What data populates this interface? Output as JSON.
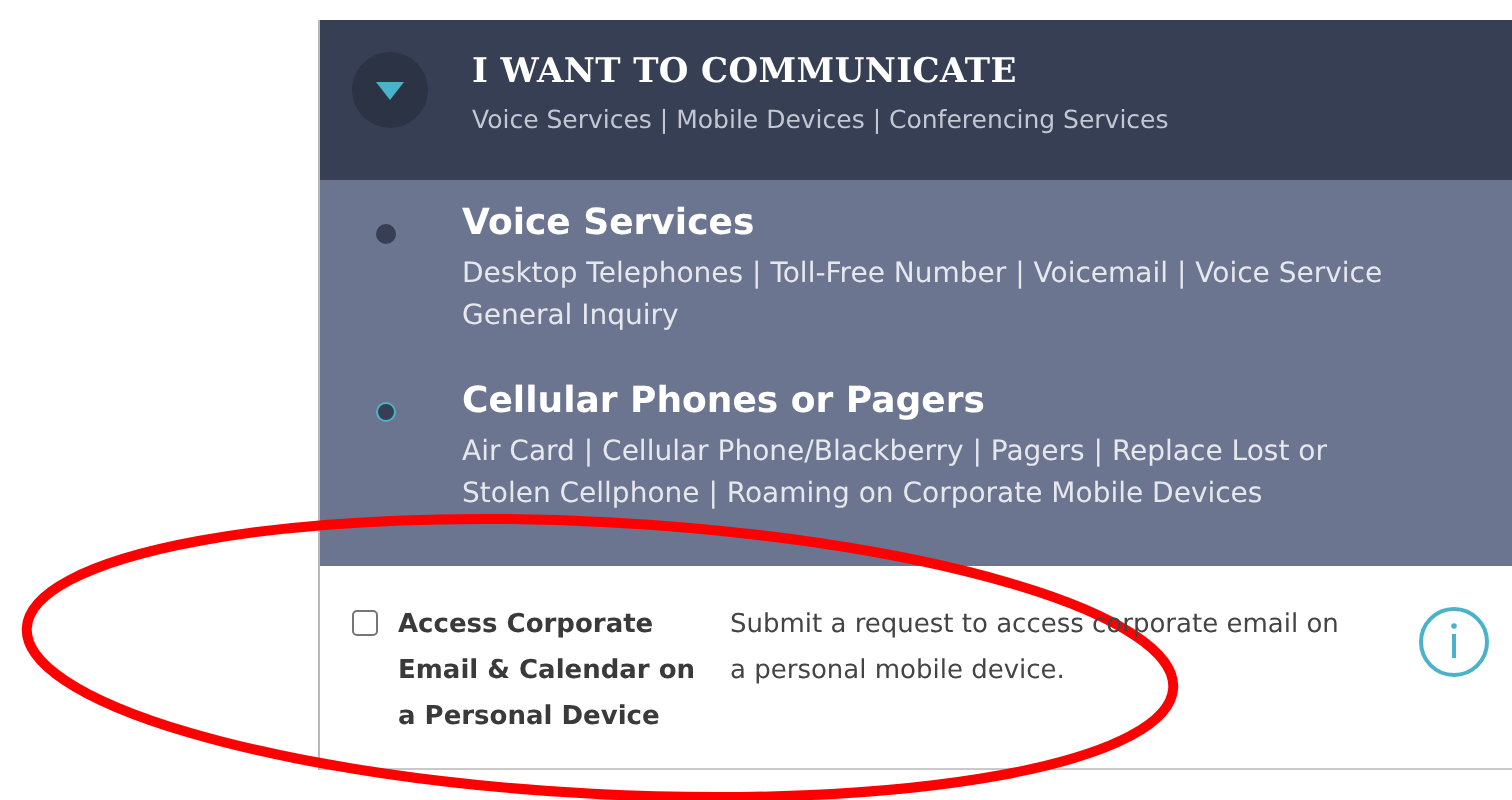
{
  "header": {
    "expanded": true,
    "title": "I WANT TO COMMUNICATE",
    "subtitle": "Voice Services | Mobile Devices | Conferencing Services"
  },
  "categories": [
    {
      "title": "Voice Services",
      "links": [
        "Desktop Telephones | Toll-Free Number | Voicemail | Voice Service",
        "General Inquiry"
      ],
      "selected": false
    },
    {
      "title": "Cellular Phones or Pagers",
      "links": [
        "Air Card | Cellular Phone/Blackberry | Pagers | Replace Lost or",
        "Stolen Cellphone | Roaming on Corporate Mobile Devices"
      ],
      "selected": true
    }
  ],
  "requests": [
    {
      "checked": false,
      "title": "Access Corporate Email & Calendar on a Personal Device",
      "description": "Submit a request to access corporate email on a personal mobile device."
    }
  ],
  "annotation": {
    "kind": "ellipse"
  }
}
